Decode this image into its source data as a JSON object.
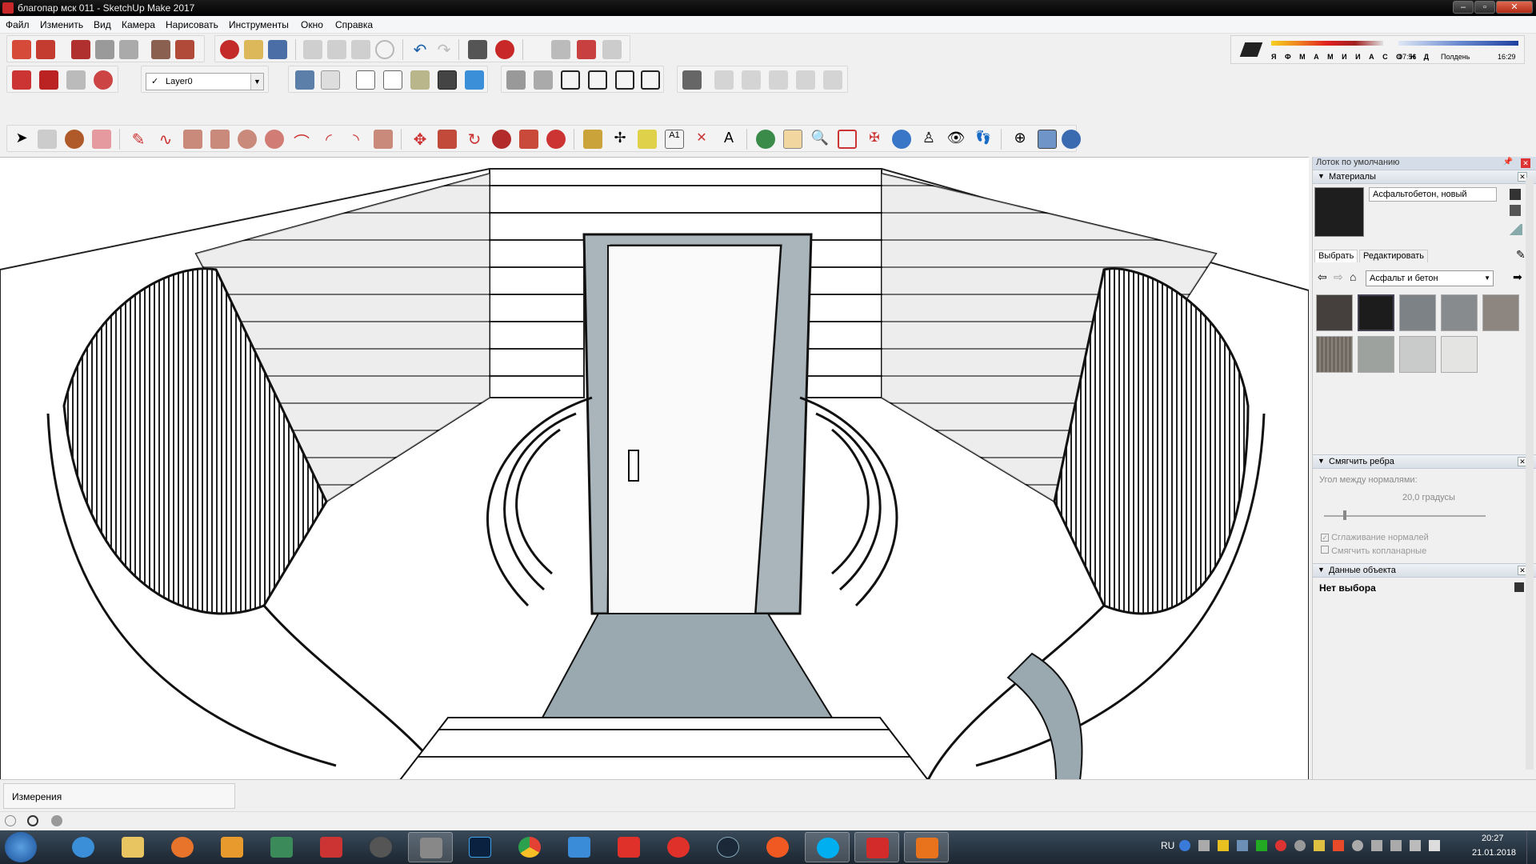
{
  "window": {
    "title": "благопар мск 011 - SketchUp Make 2017",
    "controls": [
      "–",
      "▫",
      "✕"
    ]
  },
  "menu": [
    "Файл",
    "Изменить",
    "Вид",
    "Камера",
    "Нарисовать",
    "Инструменты",
    "Окно",
    "Справка"
  ],
  "layers": {
    "current": "Layer0"
  },
  "shadows": {
    "months": "Я Ф М А М И И А С О Н Д",
    "time_start": "07:56",
    "time_mid": "Полдень",
    "time_end": "16:29"
  },
  "tray": {
    "title": "Лоток по умолчанию",
    "materials": {
      "header": "Материалы",
      "material_name": "Асфальтобетон, новый",
      "tab_select": "Выбрать",
      "tab_edit": "Редактировать",
      "collection": "Асфальт и бетон",
      "swatch_colors": [
        "#45403e",
        "#1c1c1c",
        "#7c8286",
        "#878b8d",
        "#8c8580",
        "#6e6860",
        "#9ea29e",
        "#c9cbcb",
        "#e4e4e2"
      ]
    },
    "soften": {
      "header": "Смягчить ребра",
      "angle_label": "Угол между нормалями:",
      "angle_value": "20,0  градусы",
      "angle_fraction": 0.12,
      "smooth_normals": "Сглаживание нормалей",
      "smooth_normals_checked": true,
      "soften_coplanar": "Смягчить копланарные",
      "soften_coplanar_checked": false
    },
    "entity": {
      "header": "Данные объекта",
      "selection": "Нет выбора"
    }
  },
  "measurements": {
    "label": "Измерения"
  },
  "taskbar": {
    "lang": "RU",
    "time": "20:27",
    "date": "21.01.2018"
  }
}
